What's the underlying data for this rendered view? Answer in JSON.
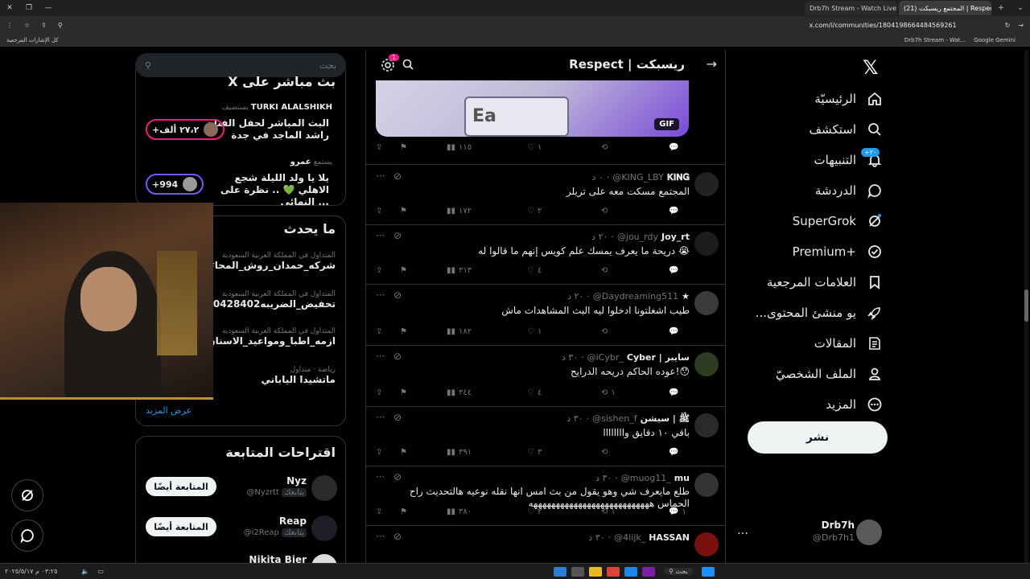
{
  "browser": {
    "tabs": [
      {
        "label": "Drb7h Stream - Watch Live on",
        "active": false
      },
      {
        "label": "(21) المجتمع ريسبكت | Respect / X",
        "active": true
      }
    ],
    "url": "x.com/i/communities/1804198664484569261",
    "bookmarks": [
      "Google Gemini",
      "Drb7h Stream - Wat...",
      "كل الإشارات المرجعية"
    ]
  },
  "nav": {
    "home": "الرئيسيّة",
    "explore": "استكشف",
    "notifications": "التنبيهات",
    "notifications_badge": "+٢٠",
    "chat": "الدردشة",
    "supergrok": "SuperGrok",
    "premium": "Premium+",
    "bookmarks": "العلامات المرجعية",
    "creator_studio": "...يو منشئ المحتوى",
    "articles": "المقالات",
    "profile": "الملف الشخصيّ",
    "more": "المزيد",
    "post_button": "نشر",
    "account_name": "Drb7h",
    "account_handle": "@Drb7h1"
  },
  "header": {
    "title": "Respect | ريسبكت",
    "settings_badge": "1"
  },
  "gif_label": "GIF",
  "gif_actions": {
    "views": "١١٥",
    "likes": "١"
  },
  "posts": [
    {
      "name": "𝐊𝐈𝐍𝐆",
      "handle": "@KING_LBY",
      "time": "٠ د",
      "text": "المجتمع مسكت معه على تريلر",
      "views": "١٧٢",
      "reposts": "",
      "likes": "٢",
      "replies": ""
    },
    {
      "name": "Joy_rt",
      "handle": "@jou_rdy",
      "time": "٢٠ د",
      "text": "دريحة ما يعرف يمسك علم كويس إنهم ما قالوا له 😭",
      "views": "٣١٣",
      "reposts": "",
      "likes": "٤",
      "replies": ""
    },
    {
      "name": "★",
      "handle": "@Daydreaming511",
      "time": "٢٠ د",
      "text": "طيب اشغلتونا ادخلوا ليه البث المشاهدات ماش",
      "views": "١٨٢",
      "reposts": "",
      "likes": "١",
      "replies": ""
    },
    {
      "name": "Cyber | سايبر",
      "handle": "@iCybr_",
      "time": "٣٠ د",
      "text": "عوده الحاكم دريحه الدرايح!😯",
      "views": "٣٤٤",
      "reposts": "١",
      "likes": "٤",
      "replies": ""
    },
    {
      "name": "ﷺ | سيشن",
      "handle": "@sishen_f",
      "time": "٣٠ د",
      "text": "باقي ١٠ دقايق واااااااا",
      "views": "٣٩١",
      "reposts": "",
      "likes": "٣",
      "replies": ""
    },
    {
      "name": "mu",
      "handle": "@muog11_",
      "time": "٣٠ د",
      "text": "طلع مايعرف شي وهو يقول من بث امس انها نقله نوعيه هالتحديث راح الحماس هههههههههههههههههههههههههههه",
      "views": "٣٨٠",
      "reposts": "١",
      "likes": "٢",
      "replies": "١"
    },
    {
      "name": "HASSAN",
      "handle": "@4iijk_",
      "time": "٣٠ د",
      "text": "",
      "views": "",
      "reposts": "",
      "likes": "",
      "replies": ""
    }
  ],
  "right": {
    "search_placeholder": "بحث",
    "live_title": "X بث مباشر على",
    "live": [
      {
        "host_label": "يستضيف",
        "host": "TURKI ALALSHIKH",
        "text": "البث المباشر لحفل الفنان راشد الماجد في جدة",
        "count": "+٢٧،٢ ألف"
      },
      {
        "host_label": "يستمع",
        "host": "عمرو",
        "text": "يلا يا ولد الليلة شجع الاهلي 💚 .. نظرة على النهائي ...",
        "count": "+994"
      }
    ],
    "trends_title": "ما يحدث",
    "trends": [
      {
        "context": "المتداول في المملكة العربية السعودية",
        "topic": "#شركه_حمدان_روش_المحا"
      },
      {
        "context": "المتداول في المملكة العربية السعودية",
        "topic": "#تخفيض_الضريبه90428402"
      },
      {
        "context": "المتداول في المملكة العربية السعودية",
        "topic": "#ازمه_اطبا_ومواعيد_الاسنان"
      },
      {
        "context": "رياضة · متداول",
        "topic": "ماتشيدا الياباني"
      }
    ],
    "show_more": "عرض المزيد",
    "follow_title": "اقتراحات المتابعة",
    "follow": [
      {
        "name": "Nyz",
        "handle": "@Nyzrtt",
        "follows_you": "يتابعك",
        "button": "المتابعة أيضًا"
      },
      {
        "name": "Reap",
        "handle": "@i2Reap",
        "follows_you": "يتابعك",
        "button": "المتابعة أيضًا"
      },
      {
        "name": "Nikita Bier",
        "handle": "",
        "follows_you": "",
        "button": ""
      }
    ]
  },
  "taskbar": {
    "search": "بحث",
    "time": "٠٣:٢٥ م",
    "date": "٢٠٢٥/٥/١٧"
  }
}
